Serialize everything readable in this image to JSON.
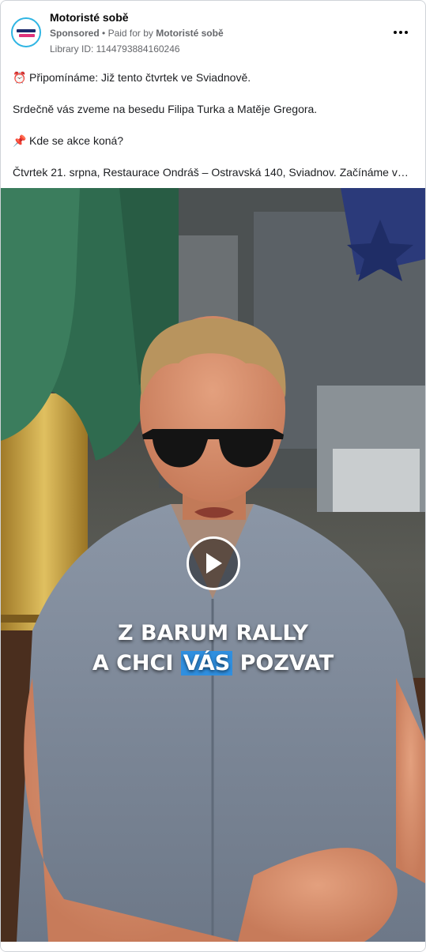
{
  "ad": {
    "page_name": "Motoristé sobě",
    "sponsored": "Sponsored",
    "separator": "•",
    "paid_for_prefix": "Paid for by",
    "paid_for_name": "Motoristé sobě",
    "library_id": "Library ID: 1144793884160246",
    "avatar_label": "MOTORISTÉ SOBĚ"
  },
  "post": {
    "paragraphs": [
      {
        "emoji": "⏰",
        "text": "Připomínáme: Již tento čtvrtek ve Sviadnově."
      },
      {
        "emoji": "",
        "text": "Srdečně vás zveme na besedu Filipa Turka a Matěje Gregora."
      },
      {
        "emoji": "📌",
        "text": "Kde se akce koná?"
      },
      {
        "emoji": "",
        "text": "Čtvrtek 21. srpna, Restaurace Ondráš – Ostravská 140, Sviadnov. Začínáme v…"
      }
    ]
  },
  "video": {
    "caption_line1": "Z BARUM RALLY",
    "caption_line2_a": "A CHCI ",
    "caption_line2_highlight": "VÁS",
    "caption_line2_b": " POZVAT",
    "highlight_color": "#2f8fe0",
    "play_icon": "play-icon"
  },
  "colors": {
    "accent_ring": "#2fb5e3",
    "umbrella": "#2f6b4f"
  }
}
